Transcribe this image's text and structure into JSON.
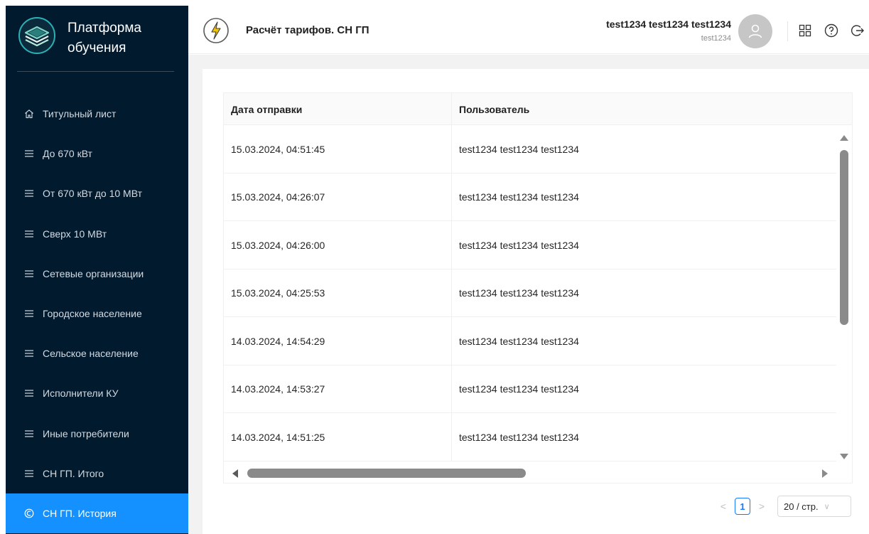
{
  "app": {
    "brand_line1": "Платформа",
    "brand_line2": "обучения"
  },
  "sidebar": {
    "items": [
      {
        "label": "Титульный лист",
        "icon": "home-icon"
      },
      {
        "label": "До 670 кВт",
        "icon": "list-icon"
      },
      {
        "label": "От 670 кВт до 10 МВт",
        "icon": "list-icon"
      },
      {
        "label": "Сверх 10 МВт",
        "icon": "list-icon"
      },
      {
        "label": "Сетевые организации",
        "icon": "list-icon"
      },
      {
        "label": "Городское население",
        "icon": "list-icon"
      },
      {
        "label": "Сельское население",
        "icon": "list-icon"
      },
      {
        "label": "Исполнители КУ",
        "icon": "list-icon"
      },
      {
        "label": "Иные потребители",
        "icon": "list-icon"
      },
      {
        "label": "СН ГП. Итого",
        "icon": "list-icon"
      },
      {
        "label": "СН ГП. История",
        "icon": "history-icon",
        "active": true
      }
    ]
  },
  "header": {
    "title": "Расчёт тарифов. СН ГП",
    "user_full_name": "test1234 test1234 test1234",
    "user_login": "test1234"
  },
  "table": {
    "columns": [
      "Дата отправки",
      "Пользователь"
    ],
    "rows": [
      [
        "15.03.2024, 04:51:45",
        "test1234 test1234 test1234"
      ],
      [
        "15.03.2024, 04:26:07",
        "test1234 test1234 test1234"
      ],
      [
        "15.03.2024, 04:26:00",
        "test1234 test1234 test1234"
      ],
      [
        "15.03.2024, 04:25:53",
        "test1234 test1234 test1234"
      ],
      [
        "14.03.2024, 14:54:29",
        "test1234 test1234 test1234"
      ],
      [
        "14.03.2024, 14:53:27",
        "test1234 test1234 test1234"
      ],
      [
        "14.03.2024, 14:51:25",
        "test1234 test1234 test1234"
      ]
    ]
  },
  "pagination": {
    "prev": "<",
    "current_page": "1",
    "next": ">",
    "page_size": "20 / стр."
  },
  "colors": {
    "sidebar_bg": "#011a2e",
    "accent": "#1590ff",
    "page_bg": "#f2f2f2"
  }
}
